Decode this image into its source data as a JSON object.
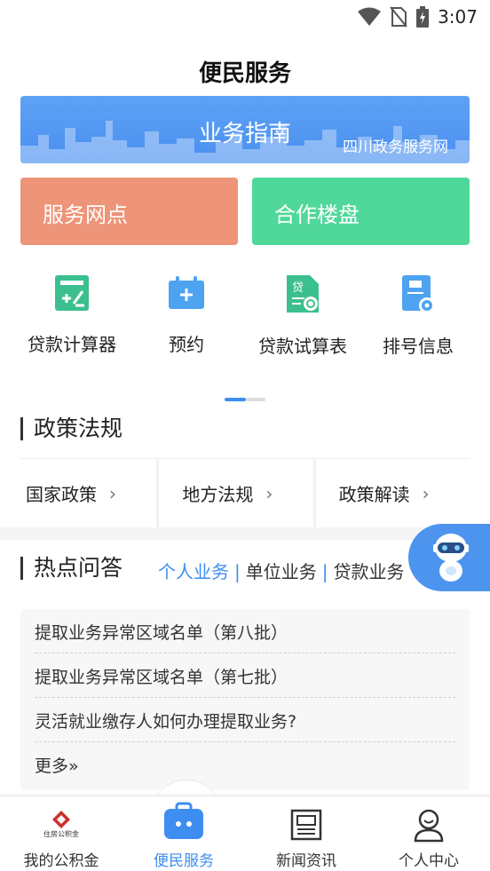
{
  "status_bar": {
    "time": "3:07",
    "icons": [
      "wifi-icon",
      "no-sim-icon",
      "battery-charging-icon"
    ]
  },
  "page_title": "便民服务",
  "banner": {
    "title": "业务指南",
    "subtitle": "四川政务服务网"
  },
  "tiles": [
    {
      "label": "服务网点",
      "color": "#ee9478"
    },
    {
      "label": "合作楼盘",
      "color": "#4fd89a"
    }
  ],
  "quick_actions": [
    {
      "label": "贷款计算器",
      "icon": "calculator-icon"
    },
    {
      "label": "预约",
      "icon": "calendar-add-icon"
    },
    {
      "label": "贷款试算表",
      "icon": "loan-sheet-icon"
    },
    {
      "label": "排号信息",
      "icon": "queue-ticket-icon"
    }
  ],
  "policy": {
    "title": "政策法规",
    "items": [
      {
        "label": "国家政策"
      },
      {
        "label": "地方法规"
      },
      {
        "label": "政策解读"
      }
    ]
  },
  "hot_qa": {
    "title": "热点问答",
    "tabs": [
      {
        "label": "个人业务"
      },
      {
        "label": "单位业务"
      },
      {
        "label": "贷款业务"
      }
    ],
    "separator": "|",
    "questions": [
      "提取业务异常区域名单（第八批）",
      "提取业务异常区域名单（第七批）",
      "灵活就业缴存人如何办理提取业务?"
    ],
    "more_label": "更多»"
  },
  "bottom_nav": {
    "items": [
      {
        "label": "我的公积金",
        "icon": "housing-fund-logo-icon"
      },
      {
        "label": "便民服务",
        "icon": "briefcase-icon"
      },
      {
        "label": "新闻资讯",
        "icon": "newspaper-icon"
      },
      {
        "label": "个人中心",
        "icon": "user-icon"
      }
    ],
    "logo_text": "住房公积金"
  },
  "colors": {
    "accent": "#3d8ef0",
    "banner": "#4a8ff0",
    "tile_red": "#ee9478",
    "tile_green": "#4fd89a"
  }
}
